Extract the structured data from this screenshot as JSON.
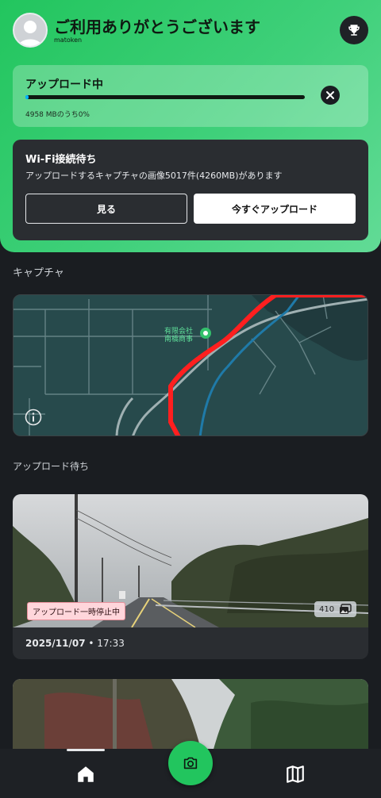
{
  "header": {
    "greeting": "ご利用ありがとうございます",
    "username": "matoken",
    "accent_color": "#22c55e"
  },
  "upload": {
    "title": "アップロード中",
    "status": "4958 MBのうち0%",
    "progress": 0
  },
  "wifi": {
    "title": "Wi-Fi接続待ち",
    "description": "アップロードするキャプチャの画像5017件(4260MB)があります",
    "view_label": "見る",
    "upload_now_label": "今すぐアップロード"
  },
  "captures": {
    "section_label": "キャプチャ",
    "map_place_label_line1": "有限会社",
    "map_place_label_line2": "南橋商事"
  },
  "pending": {
    "section_label": "アップロード待ち",
    "item": {
      "status_badge": "アップロード一時停止中",
      "image_count": "410",
      "date": "2025/11/07",
      "time": "• 17:33"
    }
  },
  "icons": {
    "trophy": "trophy-icon",
    "close": "close-icon",
    "info": "info-icon",
    "home": "home-icon",
    "camera": "camera-icon",
    "map": "map-icon",
    "images": "images-icon"
  }
}
